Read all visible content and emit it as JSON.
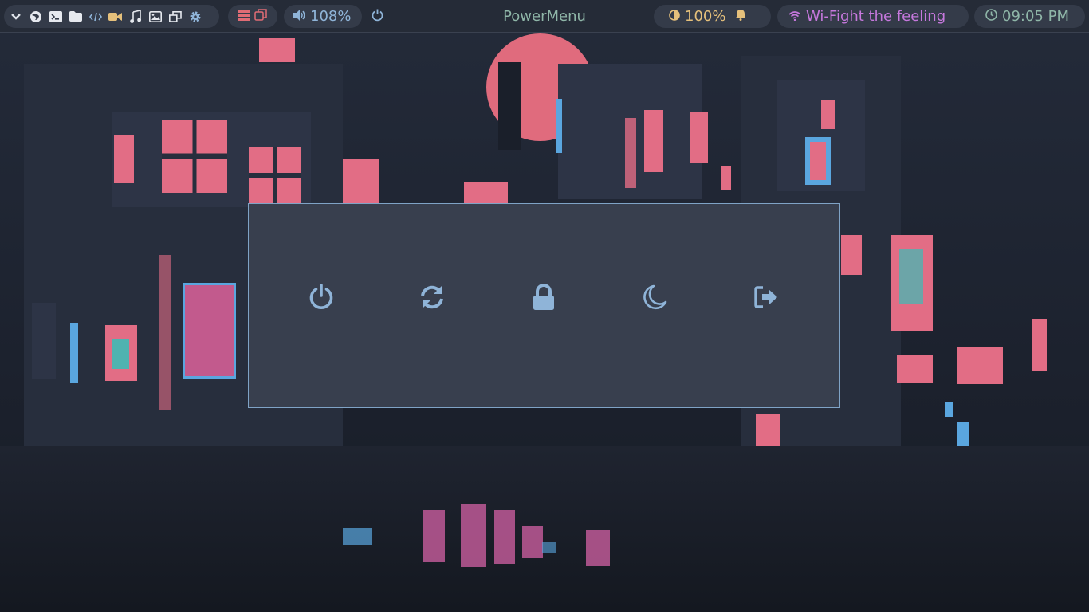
{
  "colors": {
    "bar_bg": "#252b37",
    "pill_bg": "#343b49",
    "menu_bg": "#383f4e",
    "menu_border": "#7fa3c6",
    "icon_light": "#e6e9ef",
    "icon_blue": "#8fb4d8",
    "accent_yellow": "#e5c07b",
    "accent_red": "#e06c75",
    "accent_green": "#8fb6a8",
    "accent_pink": "#c678dd"
  },
  "topbar": {
    "launcher_icons": [
      "chevron-down-icon",
      "firefox-icon",
      "terminal-icon",
      "folder-icon",
      "code-icon",
      "video-icon",
      "music-icon",
      "image-icon",
      "window-icon",
      "gear-icon"
    ],
    "workspace_icons": [
      "grid-icon",
      "windows-icon"
    ],
    "volume": {
      "icon": "volume-icon",
      "value": "108%"
    },
    "power_icon": "power-icon",
    "title": "PowerMenu",
    "brightness": {
      "icon": "brightness-icon",
      "value": "100%"
    },
    "notification_icon": "bell-icon",
    "wifi": {
      "icon": "wifi-icon",
      "ssid": "Wi-Fight the feeling"
    },
    "clock": {
      "icon": "clock-icon",
      "time": "09:05 PM"
    }
  },
  "power_menu": {
    "buttons": [
      {
        "id": "shutdown",
        "icon": "power-icon"
      },
      {
        "id": "reboot",
        "icon": "refresh-icon"
      },
      {
        "id": "lock",
        "icon": "lock-icon"
      },
      {
        "id": "sleep",
        "icon": "moon-icon"
      },
      {
        "id": "logout",
        "icon": "logout-icon"
      }
    ]
  }
}
